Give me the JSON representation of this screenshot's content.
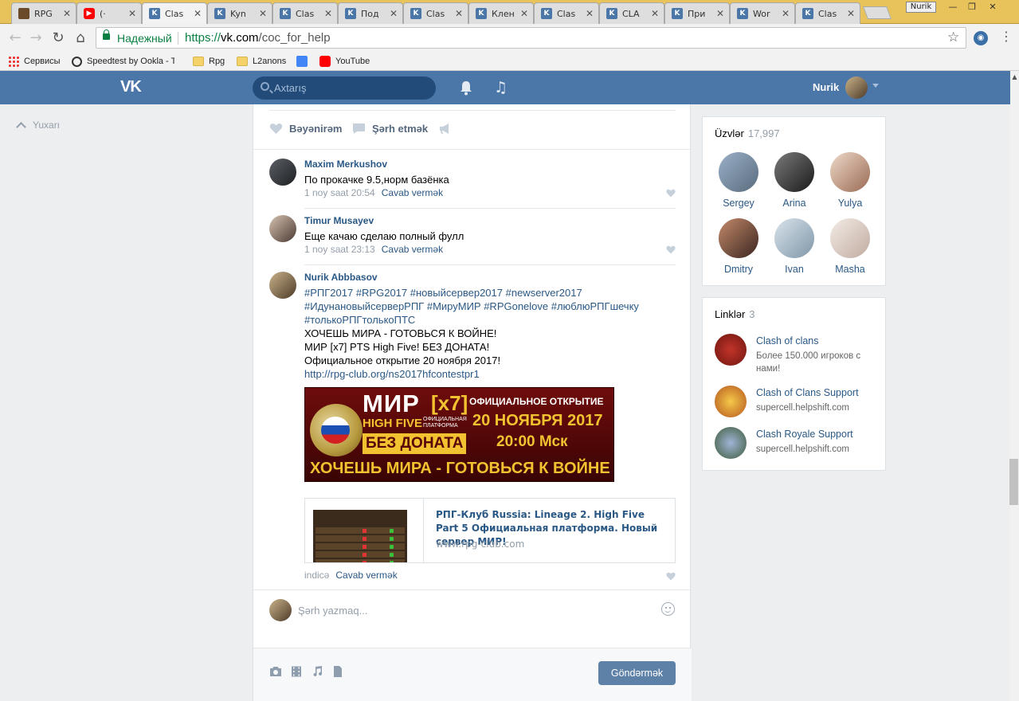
{
  "browser": {
    "tabs": [
      {
        "title": "RPG",
        "icon": "rpg-favicon",
        "active": false
      },
      {
        "title": "(·",
        "icon": "youtube-favicon",
        "active": false
      },
      {
        "title": "Clas",
        "icon": "vk-favicon",
        "active": true
      },
      {
        "title": "Kyn",
        "icon": "vk-favicon",
        "active": false
      },
      {
        "title": "Clas",
        "icon": "vk-favicon",
        "active": false
      },
      {
        "title": "Под",
        "icon": "vk-favicon",
        "active": false
      },
      {
        "title": "Clas",
        "icon": "vk-favicon",
        "active": false
      },
      {
        "title": "Клен",
        "icon": "vk-favicon",
        "active": false
      },
      {
        "title": "Clas",
        "icon": "vk-favicon",
        "active": false
      },
      {
        "title": "CLA",
        "icon": "vk-favicon",
        "active": false
      },
      {
        "title": "При",
        "icon": "vk-favicon",
        "active": false
      },
      {
        "title": "Wor",
        "icon": "vk-favicon",
        "active": false
      },
      {
        "title": "Clas",
        "icon": "vk-favicon",
        "active": false
      }
    ],
    "profile_chip": "Nurik",
    "secure_label": "Надежный",
    "url_protocol": "https://",
    "url_host": "vk.com",
    "url_path": "/coc_for_help",
    "bookmarks": [
      {
        "label": "Сервисы",
        "icon": "apps-icon"
      },
      {
        "label": "Speedtest by Ookla - Th",
        "icon": "speedtest-icon"
      },
      {
        "label": "Rpg",
        "icon": "folder-icon"
      },
      {
        "label": "L2anons",
        "icon": "folder-icon"
      },
      {
        "label": "",
        "icon": "google-translate-icon"
      },
      {
        "label": "YouTube",
        "icon": "youtube-icon"
      }
    ]
  },
  "vk": {
    "logo": "VK",
    "search_placeholder": "Axtarış",
    "user_name": "Nurik",
    "up_link": "Yuxarı",
    "post_actions": {
      "like": "Bəyənirəm",
      "comment": "Şərh etmək"
    },
    "comments": [
      {
        "author": "Maxim Merkushov",
        "text": "По прокачке 9.5,норм базёнка",
        "date": "1 noy saat 20:54",
        "reply": "Cavab vermək"
      },
      {
        "author": "Timur Musayev",
        "text": "Еще качаю сделаю полный фулл",
        "date": "1 noy saat 23:13",
        "reply": "Cavab vermək"
      },
      {
        "author": "Nurik Abbbasov",
        "hashtags_1": "#РПГ2017 #RPG2017 #новыйсервер2017 #newserver2017",
        "hashtags_2": "#ИдунановыйсерверРПГ #МируМИР #RPGonelove #люблюРПГшечку",
        "hashtags_3": "#толькоРПГтолькоПТС",
        "line_1": "ХОЧЕШЬ МИРА - ГОТОВЬСЯ К ВОЙНЕ!",
        "line_2": "МИР [x7] PTS High Five! БЕЗ ДОНАТА!",
        "line_3": "Официальное открытие 20 ноября 2017!",
        "link": "http://rpg-club.org/ns2017hfcontestpr1",
        "date": "indicə",
        "reply": "Cavab vermək"
      }
    ],
    "banner": {
      "mir": "МИР",
      "x7": "[x7]",
      "high_five": "HIGH FIVE",
      "platform": "ОФИЦИАЛЬНАЯ ПЛАТФОРМА",
      "no_donate": "БЕЗ ДОНАТА",
      "opening": "ОФИЦИАЛЬНОЕ ОТКРЫТИЕ",
      "date": "20 НОЯБРЯ 2017",
      "time": "20:00 Мск",
      "slogan": "ХОЧЕШЬ МИРА - ГОТОВЬСЯ К ВОЙНЕ"
    },
    "link_card": {
      "title": "РПГ-Клуб Russia: Lineage 2. High Five Part 5 Официальная платформа. Новый сервер МИР!",
      "domain": "www.rpg-club.com"
    },
    "compose": {
      "placeholder": "Şərh yazmaq...",
      "send": "Göndərmək"
    },
    "members": {
      "title": "Üzvlər",
      "count": "17,997",
      "people": [
        {
          "name": "Sergey",
          "color": "#7d8ea3"
        },
        {
          "name": "Arina",
          "color": "#3a3a3a"
        },
        {
          "name": "Yulya",
          "color": "#c7a08a"
        },
        {
          "name": "Dmitry",
          "color": "#8a5a4a"
        },
        {
          "name": "Ivan",
          "color": "#9fb5c7"
        },
        {
          "name": "Masha",
          "color": "#d8c8c0"
        }
      ]
    },
    "links": {
      "title": "Linklər",
      "count": "3",
      "items": [
        {
          "title": "Clash of clans",
          "sub": "Более 150.000 игроков с нами!",
          "color": "#a8261e"
        },
        {
          "title": "Clash of Clans Support",
          "sub": "supercell.helpshift.com",
          "color": "#e0a72a"
        },
        {
          "title": "Clash Royale Support",
          "sub": "supercell.helpshift.com",
          "color": "#6b8a4a"
        }
      ]
    },
    "colors": {
      "header": "#4a76a8",
      "link": "#2a5885",
      "meta": "#939ea9"
    }
  }
}
